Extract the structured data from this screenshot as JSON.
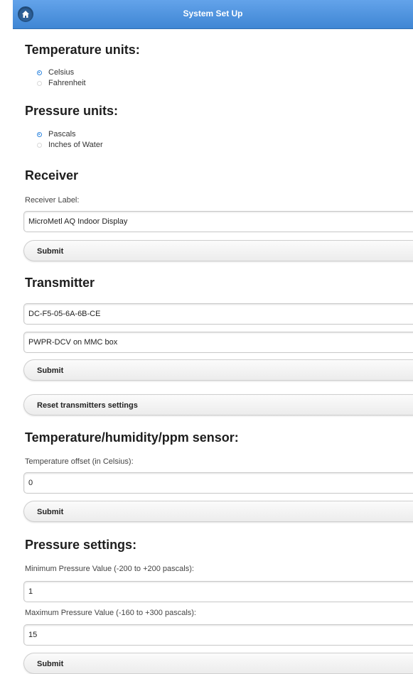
{
  "header": {
    "title": "System Set Up",
    "home_icon": "home-icon"
  },
  "temperature_units": {
    "heading": "Temperature units:",
    "options": [
      {
        "label": "Celsius",
        "selected": true
      },
      {
        "label": "Fahrenheit",
        "selected": false
      }
    ]
  },
  "pressure_units": {
    "heading": "Pressure units:",
    "options": [
      {
        "label": "Pascals",
        "selected": true
      },
      {
        "label": "Inches of Water",
        "selected": false
      }
    ]
  },
  "receiver": {
    "heading": "Receiver",
    "label_caption": "Receiver Label:",
    "label_value": "MicroMetl AQ Indoor Display",
    "submit": "Submit"
  },
  "transmitter": {
    "heading": "Transmitter",
    "mac_value": "DC-F5-05-6A-6B-CE",
    "name_value": "PWPR-DCV on MMC box",
    "submit": "Submit",
    "reset": "Reset transmitters settings"
  },
  "sensor": {
    "heading": "Temperature/humidity/ppm sensor:",
    "offset_caption": "Temperature offset (in Celsius):",
    "offset_value": "0",
    "submit": "Submit"
  },
  "pressure_settings": {
    "heading": "Pressure settings:",
    "min_caption": "Minimum Pressure Value (-200 to +200 pascals):",
    "min_value": "1",
    "max_caption": "Maximum Pressure Value (-160 to +300 pascals):",
    "max_value": "15",
    "submit": "Submit"
  },
  "colors": {
    "header_blue": "#4a8ed8",
    "radio_blue": "#2f86de"
  }
}
